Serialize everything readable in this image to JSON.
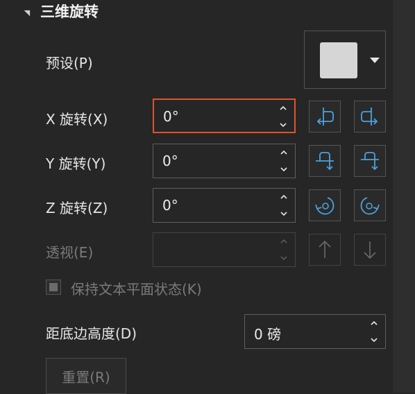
{
  "section": {
    "title": "三维旋转"
  },
  "preset": {
    "label": "预设(P)"
  },
  "x_rotation": {
    "label": "X 旋转(X)",
    "value": "0°"
  },
  "y_rotation": {
    "label": "Y 旋转(Y)",
    "value": "0°"
  },
  "z_rotation": {
    "label": "Z 旋转(Z)",
    "value": "0°"
  },
  "perspective": {
    "label": "透视(E)",
    "value": ""
  },
  "keep_text_flat": {
    "label": "保持文本平面状态(K)"
  },
  "distance_from_ground": {
    "label": "距底边高度(D)",
    "value": "0 磅"
  },
  "reset": {
    "label": "重置(R)"
  },
  "colors": {
    "accent_icon": "#4aa3df",
    "focus_border": "#e0522d",
    "background": "#262626"
  }
}
